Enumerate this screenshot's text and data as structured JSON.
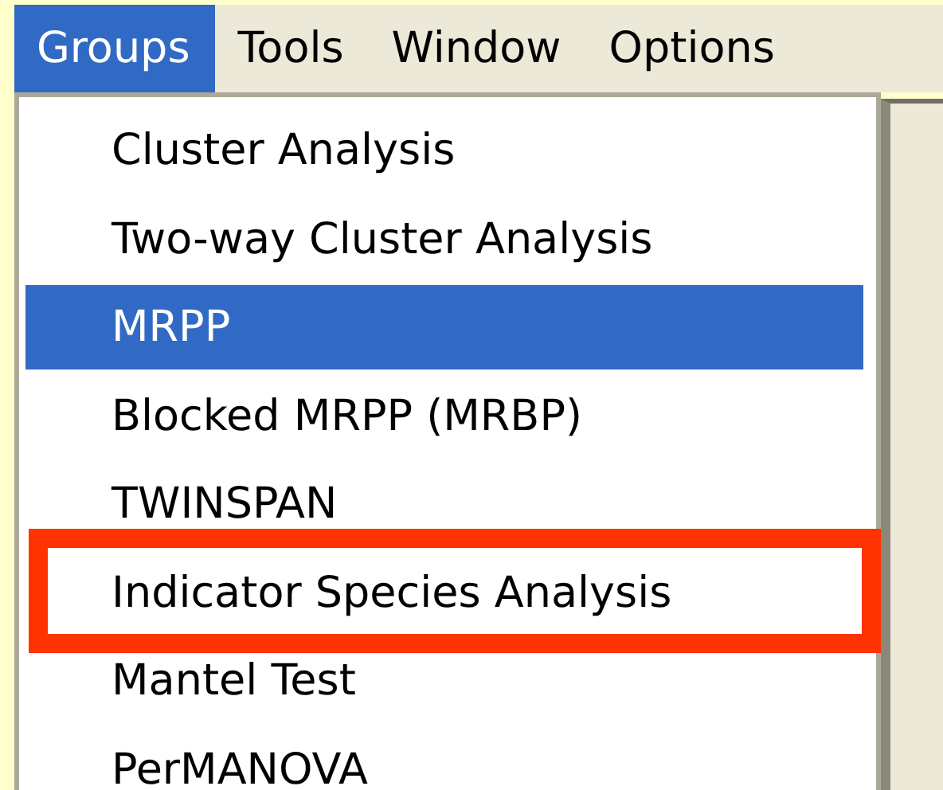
{
  "menu_bar": [
    {
      "label": "Groups",
      "selected": true
    },
    {
      "label": "Tools",
      "selected": false
    },
    {
      "label": "Window",
      "selected": false
    },
    {
      "label": "Options",
      "selected": false
    }
  ],
  "menu": {
    "items": [
      {
        "label": "Cluster Analysis",
        "selected": false,
        "highlighted": false
      },
      {
        "label": "Two-way Cluster Analysis",
        "selected": false,
        "highlighted": false
      },
      {
        "label": "MRPP",
        "selected": true,
        "highlighted": false
      },
      {
        "label": "Blocked MRPP (MRBP)",
        "selected": false,
        "highlighted": false
      },
      {
        "label": "TWINSPAN",
        "selected": false,
        "highlighted": false
      },
      {
        "label": "Indicator Species Analysis",
        "selected": false,
        "highlighted": true
      },
      {
        "label": "Mantel Test",
        "selected": false,
        "highlighted": false
      },
      {
        "label": "PerMANOVA",
        "selected": false,
        "highlighted": false
      }
    ]
  }
}
